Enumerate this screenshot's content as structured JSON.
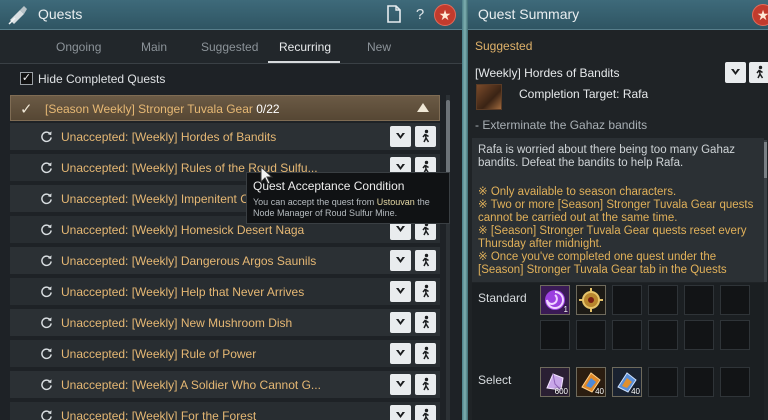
{
  "left_window": {
    "title": "Quests",
    "tabs": [
      {
        "label": "Ongoing"
      },
      {
        "label": "Main"
      },
      {
        "label": "Suggested"
      },
      {
        "label": "Recurring"
      },
      {
        "label": "New"
      }
    ],
    "active_tab": "Recurring",
    "hide_completed": {
      "label": "Hide Completed Quests",
      "checked": true
    },
    "group": {
      "title": "[Season Weekly] Stronger Tuvala Gear",
      "count": "0/22",
      "expanded": true
    },
    "quests": [
      {
        "label": "Unaccepted: [Weekly] Hordes of Bandits"
      },
      {
        "label": "Unaccepted: [Weekly] Rules of the Roud Sulfu..."
      },
      {
        "label": "Unaccepted: [Weekly] Impenitent C"
      },
      {
        "label": "Unaccepted: [Weekly] Homesick Desert Naga"
      },
      {
        "label": "Unaccepted: [Weekly] Dangerous Argos Saunils"
      },
      {
        "label": "Unaccepted: [Weekly] Help that Never Arrives"
      },
      {
        "label": "Unaccepted: [Weekly] New Mushroom Dish"
      },
      {
        "label": "Unaccepted: [Weekly] Rule of Power"
      },
      {
        "label": "Unaccepted: [Weekly] A Soldier Who Cannot G..."
      },
      {
        "label": "Unaccepted: [Weekly] For the Forest"
      }
    ]
  },
  "tooltip": {
    "title": "Quest Acceptance Condition",
    "body_pre": "You can accept the quest from ",
    "body_highlight": "Ustouvan",
    "body_post": " the Node Manager of Roud Sulfur Mine."
  },
  "right_window": {
    "title": "Quest Summary",
    "section": "Suggested",
    "quest_title": "[Weekly] Hordes of Bandits",
    "completion_target": "Completion Target: Rafa",
    "objective": "- Exterminate the Gahaz bandits",
    "description": "Rafa is worried about there being too many Gahaz bandits. Defeat the bandits to help Rafa.",
    "notes": [
      "※ Only available to season characters.",
      "※ Two or more [Season] Stronger Tuvala Gear quests cannot be carried out at the same time.",
      "※ [Season] Stronger Tuvala Gear quests reset every Thursday after midnight.",
      "※ Once you've completed one quest under the [Season] Stronger Tuvala Gear tab in the Quests"
    ],
    "rewards": {
      "standard_label": "Standard",
      "standard_items": [
        {
          "icon": "purple-swirl-orb-icon",
          "count": "1"
        },
        {
          "icon": "gold-medallion-icon",
          "count": ""
        }
      ],
      "select_label": "Select",
      "select_items": [
        {
          "icon": "purple-crystal-stone-icon",
          "count": "600"
        },
        {
          "icon": "orange-blue-gem-icon",
          "count": "40"
        },
        {
          "icon": "blue-orange-gem-icon",
          "count": "40"
        }
      ]
    }
  },
  "colors": {
    "quest_text": "#e6b874",
    "group_bar": "#6b5a45",
    "titlebar": "#3e6a7a",
    "notes_text": "#e1b15a",
    "star_button": "#c23b2d"
  }
}
